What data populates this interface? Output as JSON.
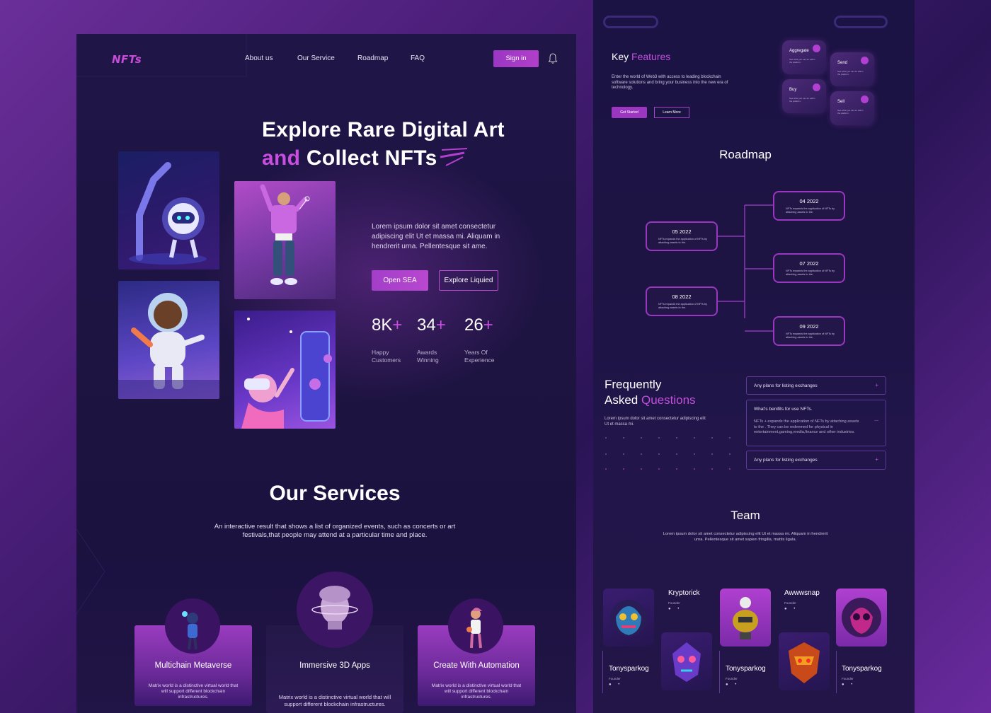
{
  "colors": {
    "accent": "#c94ee0",
    "button": "#a33ec9",
    "panel_bg": "#1e1442"
  },
  "left": {
    "logo": "NFTs",
    "nav": [
      "About us",
      "Our Service",
      "Roadmap",
      "FAQ"
    ],
    "signin": "Sign in",
    "bell_icon": "bell-icon",
    "hero": {
      "title_line1": "Explore Rare Digital Art",
      "title_line2_accent": "and",
      "title_line2_rest": " Collect NFTs",
      "description": "Lorem ipsum dolor sit amet consectetur adipiscing elit Ut et massa mi. Aliquam in hendrerit urna. Pellentesque sit ame.",
      "primary_button": "Open SEA",
      "secondary_button": "Explore Liquied",
      "stats": [
        {
          "num": "8K",
          "plus": "+",
          "label1": "Happy",
          "label2": "Customers"
        },
        {
          "num": "34",
          "plus": "+",
          "label1": "Awards",
          "label2": "Winning"
        },
        {
          "num": "26",
          "plus": "+",
          "label1": "Years Of",
          "label2": "Experience"
        }
      ]
    },
    "services": {
      "title": "Our Services",
      "description": "An interactive result that shows a list of organized events, such as concerts or art festivals,that people may attend at a particular time and place.",
      "cards": [
        {
          "title": "Multichain Metaverse",
          "desc": "Matrix world is a distinctive virtual world that will support different blockchain infrastructures."
        },
        {
          "title": "Immersive 3D Apps",
          "desc": "Matrix world is a distinctive virtual world that will support different blockchain infrastructures."
        },
        {
          "title": "Create With Automation",
          "desc": "Matrix world is a distinctive virtual world that will support different blockchain infrastructures."
        }
      ]
    }
  },
  "right": {
    "key_features": {
      "title": "Key",
      "title_accent": " Features",
      "description": "Enter the world of Web3 with access to leading blockchain software solutions and bring your business into the new era of technology.",
      "btn_start": "Get Started",
      "btn_more": "Learn More",
      "features": [
        {
          "label": "Aggregate",
          "desc": "See what you can do within the platform."
        },
        {
          "label": "Send",
          "desc": "See what you can do within the platform."
        },
        {
          "label": "Buy",
          "desc": "See what you can do within the platform."
        },
        {
          "label": "Sell",
          "desc": "See what you can do within the platform."
        }
      ]
    },
    "roadmap": {
      "title": "Roadmap",
      "items": [
        {
          "date": "04 2022",
          "text": "NFTs expands the application of NFTs by attaching assets to the."
        },
        {
          "date": "05 2022",
          "text": "NFTs expands the application of NFTs by attaching assets to the."
        },
        {
          "date": "07 2022",
          "text": "NFTs expands the application of NFTs by attaching assets to the."
        },
        {
          "date": "08 2022",
          "text": "NFTs expands the application of NFTs by attaching assets to the."
        },
        {
          "date": "09 2022",
          "text": "NFTs expands the application of NFTs by attaching assets to the."
        }
      ]
    },
    "faq": {
      "title1": "Frequently",
      "title2": "Asked ",
      "title2_accent": "Questions",
      "description": "Lorem ipsum dolor sit amet consectetur adipiscing elit Ut et massa mi.",
      "items": [
        {
          "q": "Any plans for listing exchanges",
          "toggle": "+"
        },
        {
          "q": "What's benifits for use NFTs.",
          "toggle": "—",
          "a": "NFTs + expands the application of NFTs by attaching assets to the . They can be redeemed for physical in entertainment,gaming,media,finance and other industries."
        },
        {
          "q": "Any plans for listing exchanges",
          "toggle": "+"
        }
      ]
    },
    "team": {
      "title": "Team",
      "description": "Lorem ipsum dolor sit amet consectetur adipiscing elit Ut et massa mi. Aliquam in hendrerit urna. Pellentesque sit amet sapien fringilla, mattis ligula.",
      "members": [
        {
          "name": "Kryptorick",
          "role": "Founder",
          "social": "● •"
        },
        {
          "name": "Awwwsnap",
          "role": "Founder",
          "social": "● •"
        },
        {
          "name": "Tonysparkog",
          "role": "Founder",
          "social": "● •"
        },
        {
          "name": "Tonysparkog",
          "role": "Founder",
          "social": "● •"
        },
        {
          "name": "Tonysparkog",
          "role": "Founder",
          "social": "● •"
        }
      ]
    }
  }
}
